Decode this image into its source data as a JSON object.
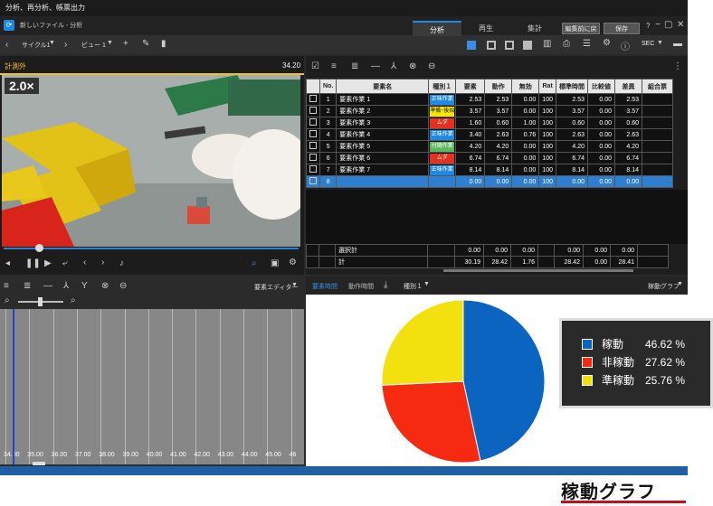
{
  "window": {
    "title": "分析、再分析、帳票出力"
  },
  "menubar": {
    "file_label": "新しいファイル - 分析",
    "tabs": [
      "分析",
      "再生",
      "集計"
    ],
    "revert_btn": "編集前に戻す",
    "save_btn": "保存",
    "win_controls": [
      "?",
      "−",
      "▢",
      "✕"
    ]
  },
  "toolbar": {
    "cycle": "サイクル1",
    "view": "ビュー 1",
    "unit": "SEC"
  },
  "video": {
    "label": "計測外",
    "time": "34.20",
    "speed": "2.0×",
    "progress": 0.12
  },
  "table": {
    "headers": [
      "No.",
      "要素名",
      "種別１",
      "要素",
      "動作",
      "無効",
      "Rat",
      "標準時間",
      "比較値",
      "差異",
      "組合票"
    ],
    "rows": [
      {
        "no": "1",
        "name": "要素作業 1",
        "type": "正味作業",
        "color": "#1e88e5",
        "v": [
          "2.53",
          "2.53",
          "0.00",
          "100",
          "2.53",
          "0.00",
          "2.53"
        ]
      },
      {
        "no": "2",
        "name": "要素作業 2",
        "type": "準備･後始",
        "color": "#f5e600",
        "v": [
          "3.57",
          "3.57",
          "0.00",
          "100",
          "3.57",
          "0.00",
          "3.57"
        ]
      },
      {
        "no": "3",
        "name": "要素作業 3",
        "type": "ムダ",
        "color": "#e53020",
        "v": [
          "1.60",
          "0.60",
          "1.00",
          "100",
          "0.60",
          "0.00",
          "0.60"
        ]
      },
      {
        "no": "4",
        "name": "要素作業 4",
        "type": "正味作業",
        "color": "#1e88e5",
        "v": [
          "3.40",
          "2.63",
          "0.76",
          "100",
          "2.63",
          "0.00",
          "2.63"
        ]
      },
      {
        "no": "5",
        "name": "要素作業 5",
        "type": "付随作業",
        "color": "#5cb85c",
        "v": [
          "4.20",
          "4.20",
          "0.00",
          "100",
          "4.20",
          "0.00",
          "4.20"
        ]
      },
      {
        "no": "6",
        "name": "要素作業 6",
        "type": "ムダ",
        "color": "#e53020",
        "v": [
          "6.74",
          "6.74",
          "0.00",
          "100",
          "6.74",
          "0.00",
          "6.74"
        ]
      },
      {
        "no": "7",
        "name": "要素作業 7",
        "type": "正味作業",
        "color": "#1e88e5",
        "v": [
          "8.14",
          "8.14",
          "0.00",
          "100",
          "8.14",
          "0.00",
          "8.14"
        ]
      },
      {
        "no": "8",
        "name": "",
        "type": "",
        "color": "",
        "v": [
          "0.00",
          "0.00",
          "0.00",
          "100",
          "0.00",
          "0.00",
          "0.00"
        ]
      }
    ],
    "summary": [
      {
        "label": "選択計",
        "v": [
          "0.00",
          "0.00",
          "0.00",
          "",
          "0.00",
          "0.00",
          "0.00"
        ]
      },
      {
        "label": "計",
        "v": [
          "30.19",
          "28.42",
          "1.76",
          "",
          "28.42",
          "0.00",
          "28.41"
        ]
      }
    ]
  },
  "timeline": {
    "editor": "要素エディター",
    "ticks": [
      "34.00",
      "35.00",
      "36.00",
      "37.00",
      "38.00",
      "39.00",
      "40.00",
      "41.00",
      "42.00",
      "43.00",
      "44.00",
      "45.00",
      "46"
    ]
  },
  "piepanel": {
    "tabs": [
      "要素時間",
      "動作時間"
    ],
    "type_sel": "種別１",
    "graph_sel": "稼動グラフ"
  },
  "chart_data": {
    "type": "pie",
    "labels": [
      "稼動",
      "非稼動",
      "準稼動"
    ],
    "values": [
      46.62,
      27.62,
      25.76
    ],
    "value_labels": [
      "46.62 %",
      "27.62 %",
      "25.76 %"
    ],
    "colors": [
      "#0a64c0",
      "#f52a10",
      "#f2e10f"
    ],
    "legend": "right"
  },
  "caption": "稼動グラフ"
}
